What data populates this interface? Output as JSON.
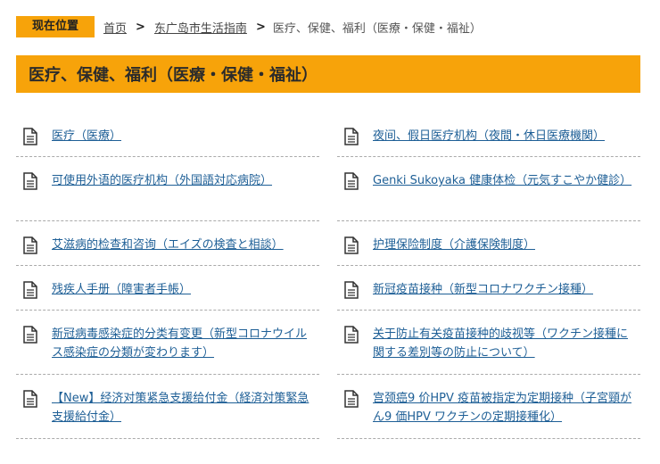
{
  "breadcrumb": {
    "here_label": "现在位置",
    "home": "首页",
    "guide": "东广岛市生活指南",
    "separator": ">",
    "current": "医疗、保健、福利（医療・保健・福祉）"
  },
  "page_title": "医疗、保健、福利（医療・保健・福祉）",
  "icons": {
    "document": "document-icon"
  },
  "colors": {
    "accent": "#f7a30a",
    "link": "#1e5f96"
  },
  "links": [
    {
      "label": "医疗（医療）"
    },
    {
      "label": "夜间、假日医疗机构（夜間・休日医療機関）"
    },
    {
      "label": "可使用外语的医疗机构（外国語対応病院）"
    },
    {
      "label": "Genki Sukoyaka 健康体检（元気すこやか健診）"
    },
    {
      "label": "艾滋病的检查和咨询（エイズの検査と相談）"
    },
    {
      "label": "护理保险制度（介護保険制度）"
    },
    {
      "label": "残疾人手册（障害者手帳）"
    },
    {
      "label": "新冠疫苗接种（新型コロナワクチン接種）"
    },
    {
      "label": "新冠病毒感染症的分类有变更（新型コロナウイルス感染症の分類が変わります）"
    },
    {
      "label": "关于防止有关疫苗接种的歧视等（ワクチン接種に関する差別等の防止について）"
    },
    {
      "label": "【New】经济对策紧急支援给付金（経済対策緊急支援給付金）"
    },
    {
      "label": "宫颈癌9 价HPV 疫苗被指定为定期接种（子宮頸がん9 価HPV ワクチンの定期接種化）"
    }
  ]
}
